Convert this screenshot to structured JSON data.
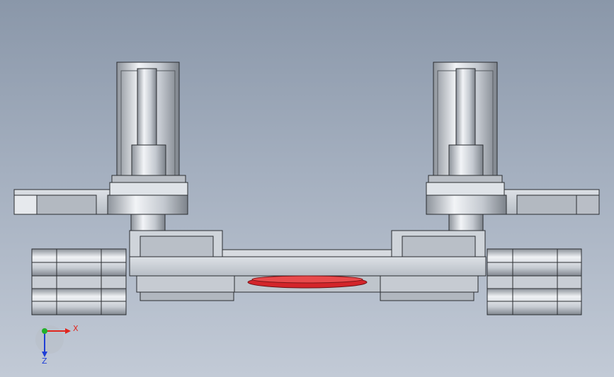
{
  "triad": {
    "x_label": "X",
    "z_label": "Z",
    "x_color": "#e0261e",
    "z_color": "#1f3fd6",
    "y_color": "#22b02a"
  },
  "colors": {
    "metal_light": "#e4e7ec",
    "metal_mid": "#c9ced6",
    "metal_dark": "#8f969f",
    "edge": "#2a2d31",
    "highlight_red": "#d3252a"
  }
}
